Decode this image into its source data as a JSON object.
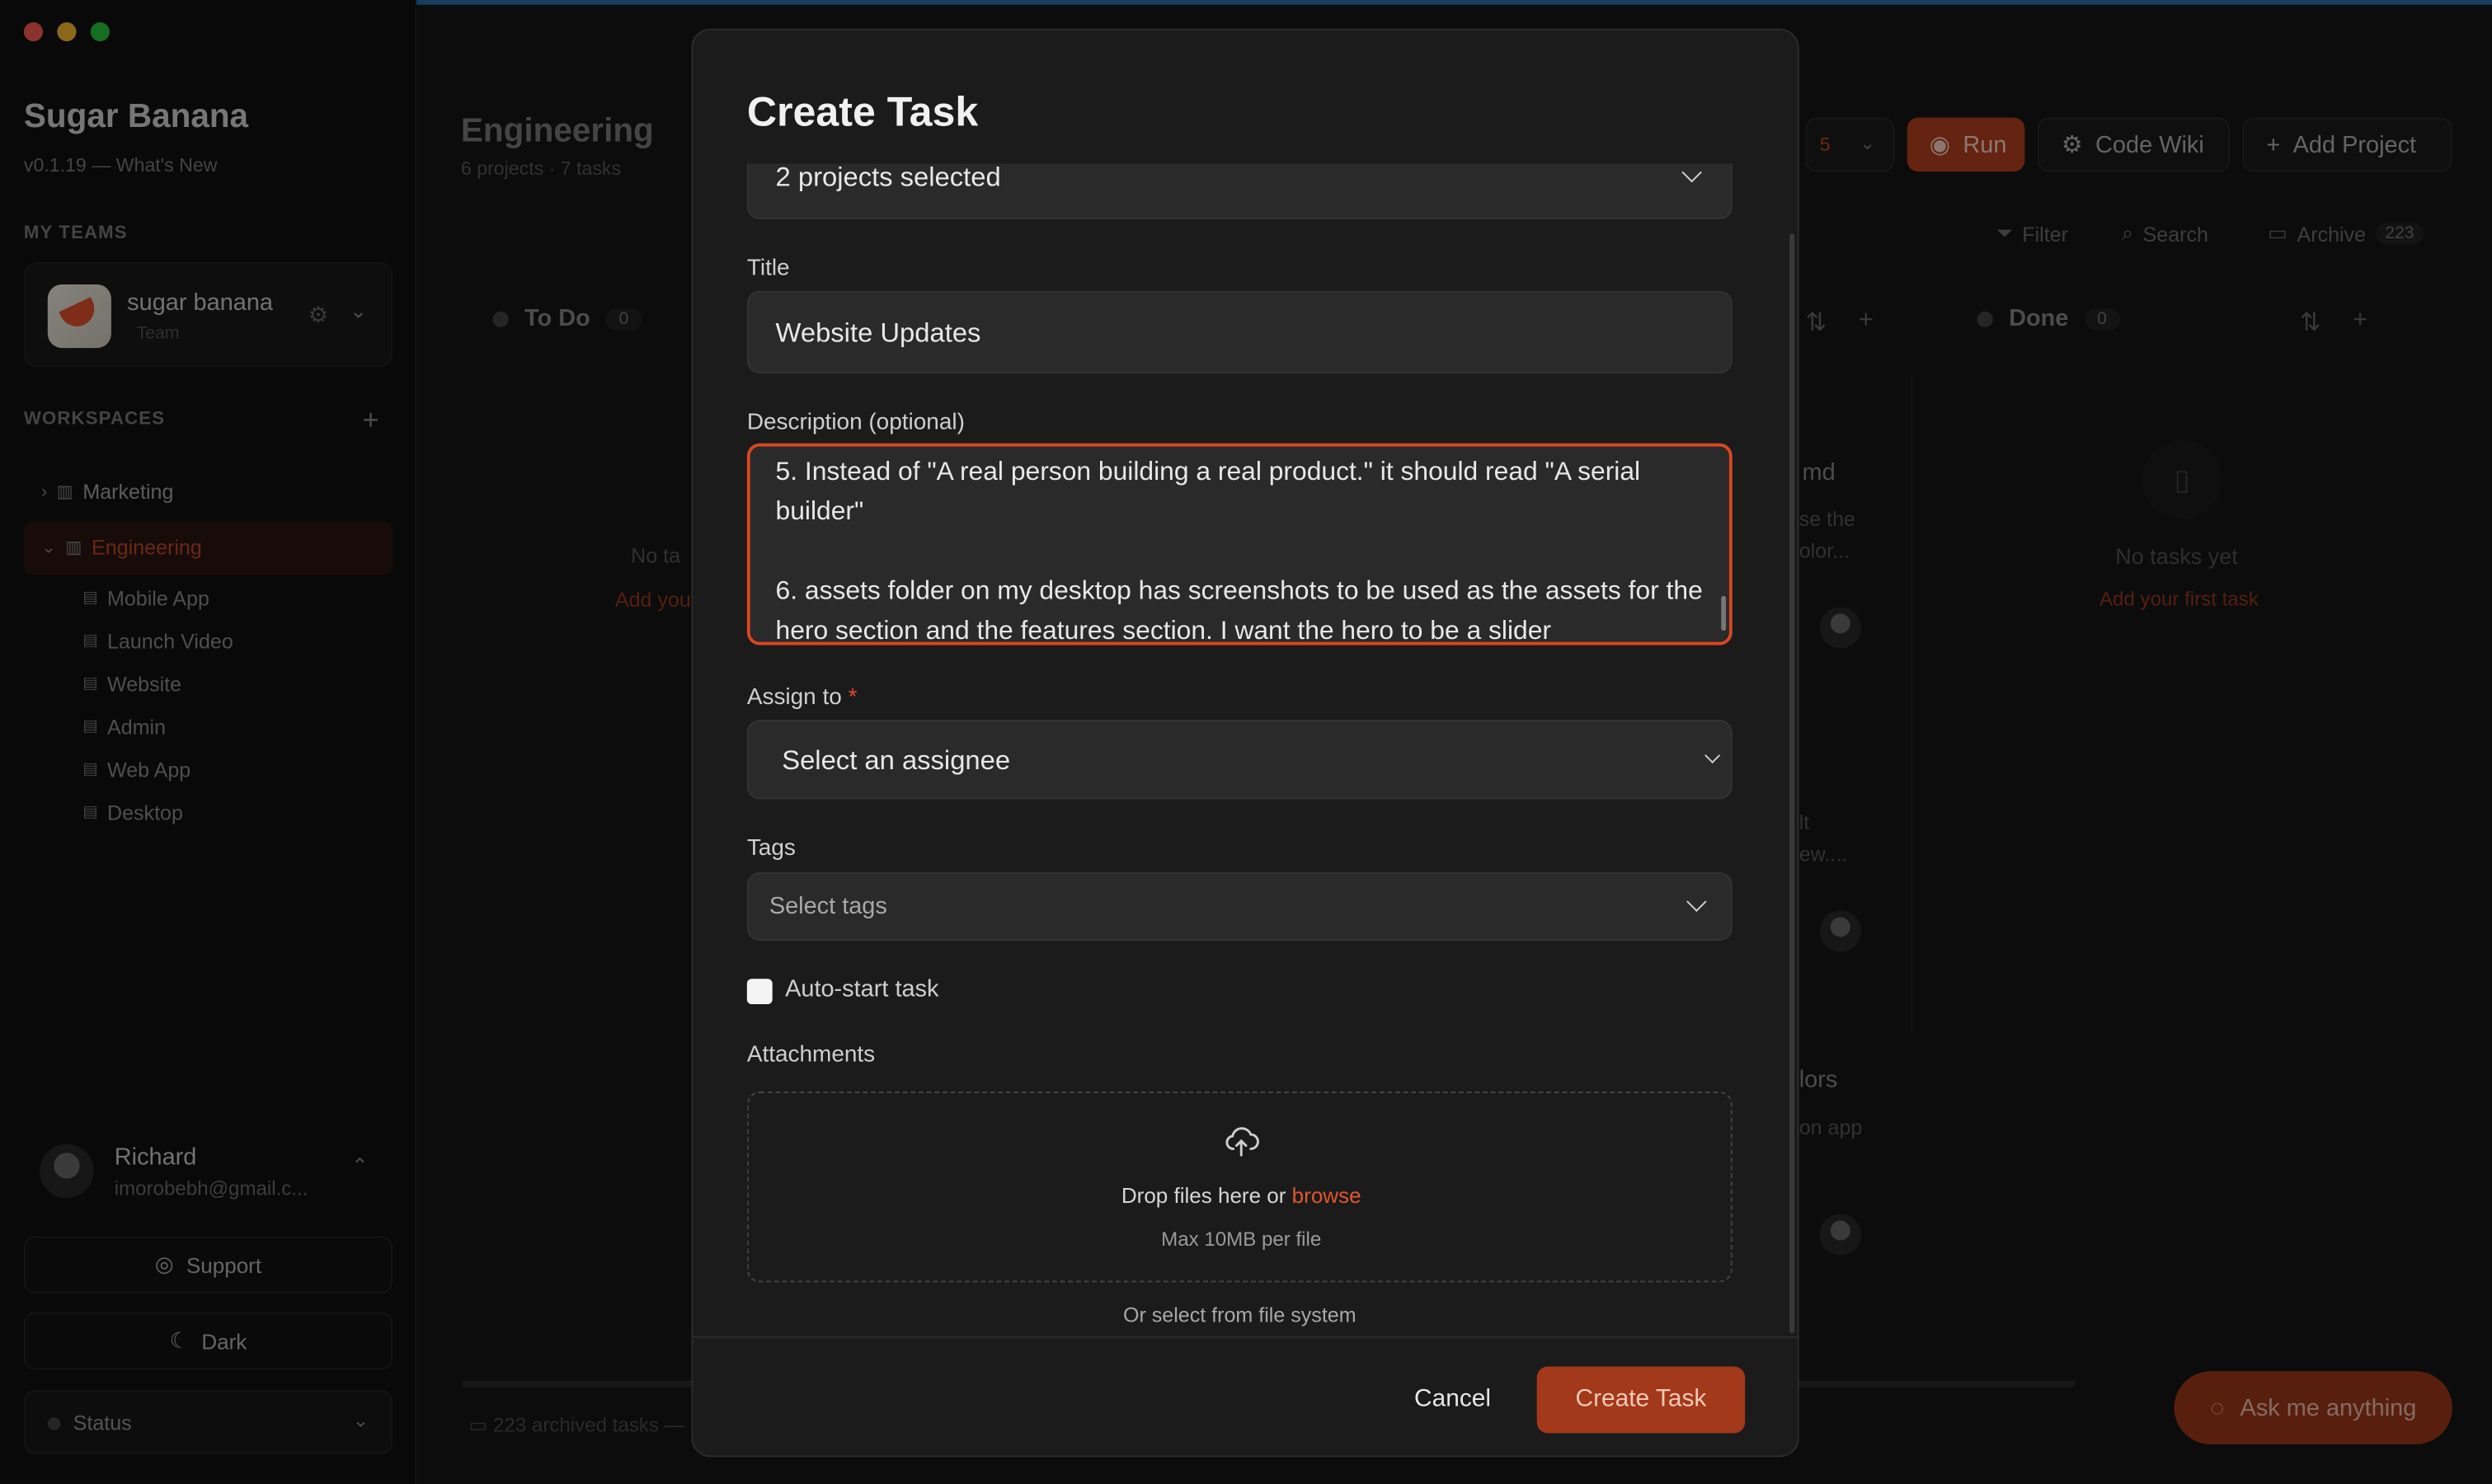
{
  "app": {
    "title": "Sugar Banana",
    "version": "v0.1.19 — What's New"
  },
  "sidebar": {
    "my_teams_label": "MY TEAMS",
    "team": {
      "name": "sugar banana",
      "sub": "Team"
    },
    "workspaces_label": "WORKSPACES",
    "workspaces": [
      {
        "label": "Marketing",
        "expanded": false
      },
      {
        "label": "Engineering",
        "expanded": true
      }
    ],
    "projects": [
      "Mobile App",
      "Launch Video",
      "Website",
      "Admin",
      "Web App",
      "Desktop"
    ],
    "user": {
      "name": "Richard",
      "email": "imorobebh@gmail.c..."
    },
    "support_label": "Support",
    "theme_label": "Dark",
    "status_label": "Status"
  },
  "main": {
    "title": "Engineering",
    "subtitle": "6 projects · 7 tasks",
    "running_count": "5",
    "run_label": "Run",
    "wiki_label": "Code Wiki",
    "add_project_label": "Add Project",
    "filter_label": "Filter",
    "search_label": "Search",
    "archive_label": "Archive",
    "archive_count": "223",
    "columns": [
      {
        "name": "To Do",
        "count": "0"
      },
      {
        "name": "Done",
        "count": "0"
      }
    ],
    "empty_text": "No tasks yet",
    "empty_link": "Add your first task",
    "peek": {
      "todo_text": "No ta",
      "todo_link": "Add you",
      "card1": "md",
      "card1_sub1": "se the",
      "card1_sub2": "olor...",
      "card2a": "lt",
      "card2b": "ew....",
      "card3": "lors",
      "card3_sub": "on app"
    },
    "archived_footer": "223 archived tasks —",
    "ask_label": "Ask me anything"
  },
  "modal": {
    "title": "Create Task",
    "projects_value": "2 projects selected",
    "title_label": "Title",
    "title_value": "Website Updates",
    "description_label": "Description (optional)",
    "description_value": "5. Instead of \"A real person building a real product.\" it should read \"A serial builder\"\n\n6. assets folder on my desktop has screenshots to be used as the assets for the hero section and the features section. I want the hero to be a slider",
    "assign_label": "Assign to",
    "assign_required": "*",
    "assign_value": "Select an assignee",
    "tags_label": "Tags",
    "tags_placeholder": "Select tags",
    "auto_start_label": "Auto-start task",
    "attachments_label": "Attachments",
    "drop_text": "Drop files here or",
    "drop_link": "browse",
    "drop_limit": "Max 10MB per file",
    "file_system_link": "Or select from file system",
    "cancel_label": "Cancel",
    "create_label": "Create Task"
  },
  "colors": {
    "accent": "#b8401f",
    "focus_border": "#d9461f",
    "link": "#e0562f"
  },
  "icons": [
    "gear-icon",
    "chevron-down-icon",
    "plus-icon",
    "board-icon",
    "file-icon",
    "support-icon",
    "moon-icon",
    "play-icon",
    "wiki-icon",
    "filter-icon",
    "search-icon",
    "archive-icon",
    "sort-icon",
    "clipboard-icon",
    "upload-icon",
    "chat-icon"
  ]
}
